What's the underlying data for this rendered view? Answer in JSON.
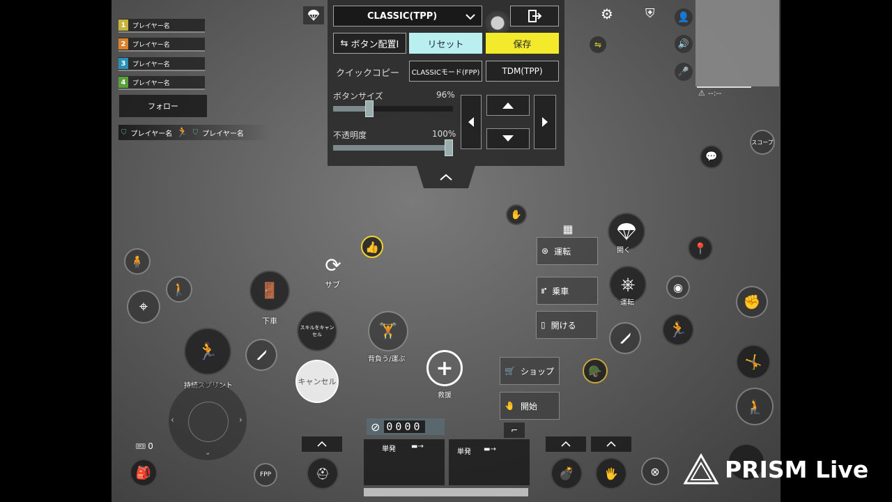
{
  "team": {
    "players": [
      {
        "num": "1",
        "name": "プレイヤー名",
        "color": "#c9b23a"
      },
      {
        "num": "2",
        "name": "プレイヤー名",
        "color": "#d9822b"
      },
      {
        "num": "3",
        "name": "プレイヤー名",
        "color": "#2a8fb5"
      },
      {
        "num": "4",
        "name": "プレイヤー名",
        "color": "#5aa03a"
      }
    ],
    "follow_label": "フォロー",
    "kill_feed": {
      "left_name": "プレイヤー名",
      "right_name": "プレイヤー名"
    }
  },
  "panel": {
    "mode_select": "CLASSIC(TPP)",
    "layout_button": "ボタン配置Ⅰ",
    "reset_button": "リセット",
    "save_button": "保存",
    "quick_copy_label": "クイックコピー",
    "copy_fpp": "CLASSICモード(FPP)",
    "copy_tdm": "TDM(TPP)",
    "size_label": "ボタンサイズ",
    "size_value": "96%",
    "size_fraction": 0.3,
    "opacity_label": "不透明度",
    "opacity_value": "100%",
    "opacity_fraction": 1.0,
    "accent_reset": "#b9f0ef",
    "accent_save": "#f2ea2a"
  },
  "controls": {
    "sub_label": "サブ",
    "exit_vehicle_label": "下車",
    "sprint_label": "持続スプリント",
    "skill_cancel_label": "スキルをキャンセル",
    "cancel_label": "キャンセル",
    "carry_label": "背負う/運ぶ",
    "revive_label": "救援",
    "drive_label": "運転",
    "ride_label": "乗車",
    "open_label": "開ける",
    "shop_label": "ショップ",
    "start_label": "開始",
    "parachute_label": "開く",
    "drive2_label": "運転",
    "scope_label": "スコープ",
    "fpp_label": "FPP",
    "ticket_count": "0",
    "ammo_counter": "0000",
    "fire_mode_left": "単発",
    "fire_mode_right": "単発",
    "minimap_status": "--:--"
  },
  "watermark": {
    "brand": "PRISM Live"
  }
}
